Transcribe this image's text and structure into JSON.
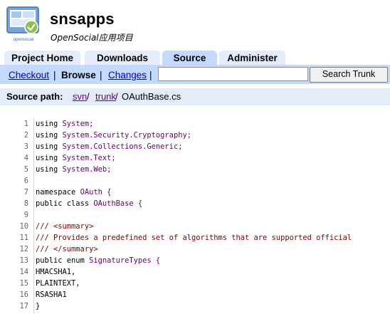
{
  "project": {
    "name": "snsapps",
    "summary": "OpenSocial应用项目",
    "logo_text": "opensocial"
  },
  "tabs": [
    {
      "label": "Project Home",
      "active": false
    },
    {
      "label": "Downloads",
      "active": false
    },
    {
      "label": "Source",
      "active": true
    },
    {
      "label": "Administer",
      "active": false
    }
  ],
  "subnav": {
    "checkout": "Checkout",
    "browse": "Browse",
    "changes": "Changes",
    "separator": "|"
  },
  "search": {
    "value": "",
    "button_label": "Search Trunk"
  },
  "source_path": {
    "label": "Source path:",
    "segments": [
      "svn",
      "trunk"
    ],
    "separator": "/",
    "file": "OAuthBase.cs"
  },
  "code_lines": [
    {
      "n": "1",
      "parts": [
        {
          "t": "using ",
          "c": ""
        },
        {
          "t": "System;",
          "c": "str"
        }
      ]
    },
    {
      "n": "2",
      "parts": [
        {
          "t": "using ",
          "c": ""
        },
        {
          "t": "System.Security.Cryptography;",
          "c": "str"
        }
      ]
    },
    {
      "n": "3",
      "parts": [
        {
          "t": "using ",
          "c": ""
        },
        {
          "t": "System.Collections.Generic;",
          "c": "str"
        }
      ]
    },
    {
      "n": "4",
      "parts": [
        {
          "t": "using ",
          "c": ""
        },
        {
          "t": "System.Text;",
          "c": "str"
        }
      ]
    },
    {
      "n": "5",
      "parts": [
        {
          "t": "using ",
          "c": ""
        },
        {
          "t": "System.Web;",
          "c": "str"
        }
      ]
    },
    {
      "n": "6",
      "parts": []
    },
    {
      "n": "7",
      "parts": [
        {
          "t": "namespace ",
          "c": ""
        },
        {
          "t": "OAuth {",
          "c": "str"
        }
      ]
    },
    {
      "n": "8",
      "parts": [
        {
          "t": "public class ",
          "c": ""
        },
        {
          "t": "OAuthBase {",
          "c": "str"
        }
      ]
    },
    {
      "n": "9",
      "parts": []
    },
    {
      "n": "10",
      "parts": [
        {
          "t": "/// <summary>",
          "c": "cmt"
        }
      ]
    },
    {
      "n": "11",
      "parts": [
        {
          "t": "/// Provides a predefined set of algorithms that are supported official",
          "c": "cmt"
        }
      ]
    },
    {
      "n": "12",
      "parts": [
        {
          "t": "/// </summary>",
          "c": "cmt"
        }
      ]
    },
    {
      "n": "13",
      "parts": [
        {
          "t": "public enum ",
          "c": ""
        },
        {
          "t": "SignatureTypes {",
          "c": "str"
        }
      ]
    },
    {
      "n": "14",
      "parts": [
        {
          "t": "HMACSHA1,",
          "c": ""
        }
      ]
    },
    {
      "n": "15",
      "parts": [
        {
          "t": "PLAINTEXT,",
          "c": ""
        }
      ]
    },
    {
      "n": "16",
      "parts": [
        {
          "t": "RSASHA1",
          "c": ""
        }
      ]
    },
    {
      "n": "17",
      "parts": [
        {
          "t": "}",
          "c": ""
        }
      ]
    }
  ],
  "colors": {
    "tab_bg": "#e5ecf9",
    "tab_active_bg": "#c3d9ff",
    "link": "#0000cc",
    "visited_link": "#660099"
  }
}
